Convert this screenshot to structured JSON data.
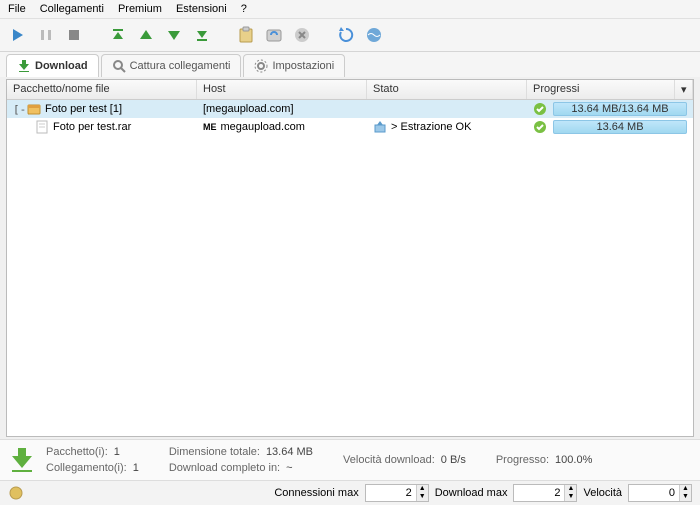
{
  "menu": {
    "items": [
      "File",
      "Collegamenti",
      "Premium",
      "Estensioni",
      "?"
    ]
  },
  "tabs": [
    {
      "label": "Download",
      "active": true
    },
    {
      "label": "Cattura collegamenti",
      "active": false
    },
    {
      "label": "Impostazioni",
      "active": false
    }
  ],
  "columns": {
    "name": "Pacchetto/nome file",
    "host": "Host",
    "status": "Stato",
    "progress": "Progressi"
  },
  "rows": [
    {
      "type": "package",
      "name": "Foto per test [1]",
      "host": "[megaupload.com]",
      "status": "",
      "progress_text": "13.64 MB/13.64 MB"
    },
    {
      "type": "file",
      "name": "Foto per test.rar",
      "host_label": "ME",
      "host": "megaupload.com",
      "status": "> Estrazione OK",
      "progress_text": "13.64 MB"
    }
  ],
  "footer": {
    "packages_label": "Pacchetto(i):",
    "packages_value": "1",
    "links_label": "Collegamento(i):",
    "links_value": "1",
    "size_label": "Dimensione totale:",
    "size_value": "13.64 MB",
    "speed_label": "Velocità download:",
    "speed_value": "0 B/s",
    "progress_label": "Progresso:",
    "progress_value": "100.0%",
    "eta_label": "Download completo in:",
    "eta_value": "~"
  },
  "statusbar": {
    "conn_label": "Connessioni max",
    "conn_value": "2",
    "dl_label": "Download max",
    "dl_value": "2",
    "speed_label": "Velocità",
    "speed_value": "0"
  }
}
